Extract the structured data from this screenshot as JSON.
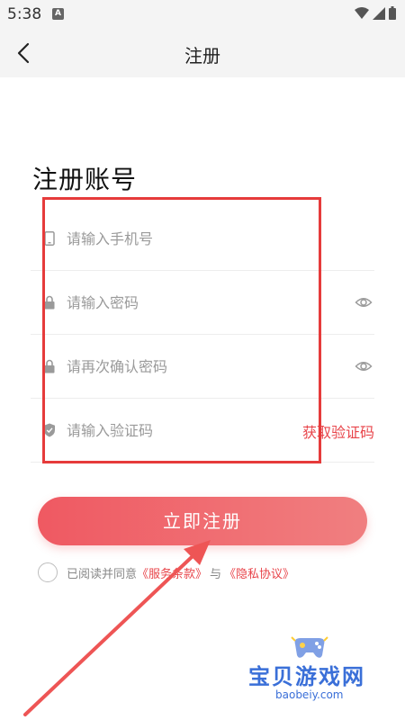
{
  "status_bar": {
    "time": "5:38",
    "notification": "A"
  },
  "nav": {
    "title": "注册"
  },
  "page": {
    "heading": "注册账号"
  },
  "form": {
    "phone_placeholder": "请输入手机号",
    "password_placeholder": "请输入密码",
    "confirm_placeholder": "请再次确认密码",
    "code_placeholder": "请输入验证码",
    "get_code_label": "获取验证码"
  },
  "actions": {
    "register_label": "立即注册"
  },
  "agreement": {
    "prefix": "已阅读并同意",
    "terms_link": "《服务条款》",
    "and": "与",
    "privacy_link": "《隐私协议》"
  },
  "watermark": {
    "title": "宝贝游戏网",
    "url": "baobeiy.com"
  },
  "colors": {
    "accent": "#e8444a",
    "annotation": "#e63b3b",
    "watermark": "#3a6fd8"
  }
}
